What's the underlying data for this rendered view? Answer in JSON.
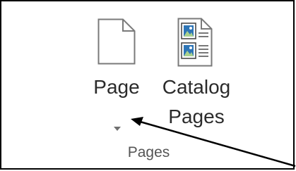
{
  "ribbon": {
    "buttons": {
      "page": {
        "label": "Page",
        "icon": "blank-page-icon"
      },
      "catalog": {
        "label_line1": "Catalog",
        "label_line2": "Pages",
        "icon": "catalog-pages-icon"
      }
    },
    "dropdown_icon": "chevron-down-icon",
    "group_label": "Pages"
  },
  "annotation": {
    "type": "arrow",
    "color": "#000000"
  }
}
